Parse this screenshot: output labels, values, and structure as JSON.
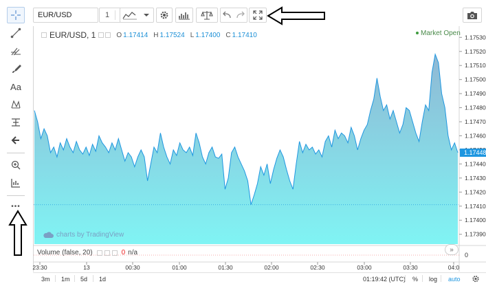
{
  "toolbar": {
    "symbol": "EUR/USD",
    "interval": "1",
    "settings_icon": "gear-icon",
    "indicators_icon": "indicators-icon",
    "compare_icon": "scales-icon",
    "fullscreen_icon": "fullscreen-icon",
    "snapshot_icon": "camera-icon"
  },
  "left_tools": [
    {
      "name": "crosshair-tool",
      "icon": "crosshair-icon"
    },
    {
      "name": "trendline-tool",
      "icon": "trendline-icon"
    },
    {
      "name": "fib-tool",
      "icon": "fib-icon"
    },
    {
      "name": "brush-tool",
      "icon": "brush-icon"
    },
    {
      "name": "text-tool",
      "icon": "text-icon",
      "label": "Aa"
    },
    {
      "name": "pattern-tool",
      "icon": "pattern-icon"
    },
    {
      "name": "prediction-tool",
      "icon": "prediction-icon"
    },
    {
      "name": "arrow-tool",
      "icon": "arrow-left-icon"
    },
    {
      "name": "zoom-tool",
      "icon": "zoom-in-icon"
    },
    {
      "name": "measure-tool",
      "icon": "measure-icon"
    },
    {
      "name": "more-tools",
      "icon": "more-icon",
      "label": "•••"
    }
  ],
  "legend": {
    "symbol": "EUR/USD, 1",
    "o_label": "O",
    "o": "1.17414",
    "h_label": "H",
    "h": "1.17524",
    "l_label": "L",
    "l": "1.17400",
    "c_label": "C",
    "c": "1.17410"
  },
  "market_status": "Market Open",
  "watermark": "charts by TradingView",
  "volume": {
    "label": "Volume (false, 20)",
    "value": "0",
    "na": "n/a"
  },
  "bottom": {
    "ranges": [
      "3m",
      "1m",
      "5d",
      "1d"
    ],
    "time": "01:19:42 (UTC)",
    "percent": "%",
    "log": "log",
    "auto": "auto"
  },
  "colors": {
    "line": "#1e96e0",
    "area_top": "#8fb8d4",
    "area_bottom": "#80f4f4",
    "last_price_bg": "#1e96e0",
    "annotation": "#000000"
  },
  "chart_data": {
    "type": "area",
    "symbol": "EUR/USD, 1",
    "y_ticks": [
      "1.17530",
      "1.17520",
      "1.17510",
      "1.17500",
      "1.17490",
      "1.17480",
      "1.17470",
      "1.17460",
      "1.17450",
      "1.17440",
      "1.17430",
      "1.17420",
      "1.17410",
      "1.17400",
      "1.17390"
    ],
    "x_ticks": [
      "23:30",
      "13",
      "00:30",
      "01:00",
      "01:30",
      "02:00",
      "02:30",
      "03:00",
      "03:30",
      "04:0"
    ],
    "ylim": [
      1.17383,
      1.17537
    ],
    "last_price": "1.17448",
    "low_marker": 1.17411,
    "volume_axis_label": "0",
    "values": [
      1.17478,
      1.1747,
      1.17458,
      1.17465,
      1.1746,
      1.17448,
      1.17452,
      1.17445,
      1.17455,
      1.1745,
      1.17458,
      1.17452,
      1.17448,
      1.17456,
      1.1745,
      1.17447,
      1.17452,
      1.17446,
      1.17454,
      1.17449,
      1.1746,
      1.17455,
      1.17452,
      1.17448,
      1.17455,
      1.1745,
      1.17458,
      1.1745,
      1.17442,
      1.17448,
      1.17445,
      1.17438,
      1.17445,
      1.1745,
      1.17445,
      1.17428,
      1.1744,
      1.17452,
      1.17448,
      1.17462,
      1.17452,
      1.17445,
      1.1744,
      1.1745,
      1.17446,
      1.17455,
      1.1745,
      1.17448,
      1.17452,
      1.17446,
      1.17462,
      1.17455,
      1.17445,
      1.1744,
      1.17448,
      1.17452,
      1.17445,
      1.17444,
      1.17447,
      1.17422,
      1.1743,
      1.17448,
      1.17452,
      1.17445,
      1.1744,
      1.17435,
      1.17428,
      1.17411,
      1.17418,
      1.17426,
      1.17438,
      1.17432,
      1.1744,
      1.17426,
      1.17436,
      1.17444,
      1.1745,
      1.17445,
      1.17436,
      1.17428,
      1.17422,
      1.1744,
      1.17456,
      1.17448,
      1.17454,
      1.1745,
      1.17452,
      1.17447,
      1.1745,
      1.17445,
      1.17456,
      1.1746,
      1.17452,
      1.17464,
      1.17458,
      1.17462,
      1.1746,
      1.17455,
      1.17466,
      1.1746,
      1.1745,
      1.17458,
      1.17464,
      1.17468,
      1.17478,
      1.17486,
      1.17501,
      1.17488,
      1.17478,
      1.17482,
      1.17472,
      1.17478,
      1.1747,
      1.17462,
      1.17468,
      1.1748,
      1.17478,
      1.1747,
      1.17462,
      1.17456,
      1.1747,
      1.17482,
      1.17478,
      1.17505,
      1.17518,
      1.17512,
      1.1749,
      1.1748,
      1.1746,
      1.1745,
      1.17455,
      1.17448
    ]
  }
}
